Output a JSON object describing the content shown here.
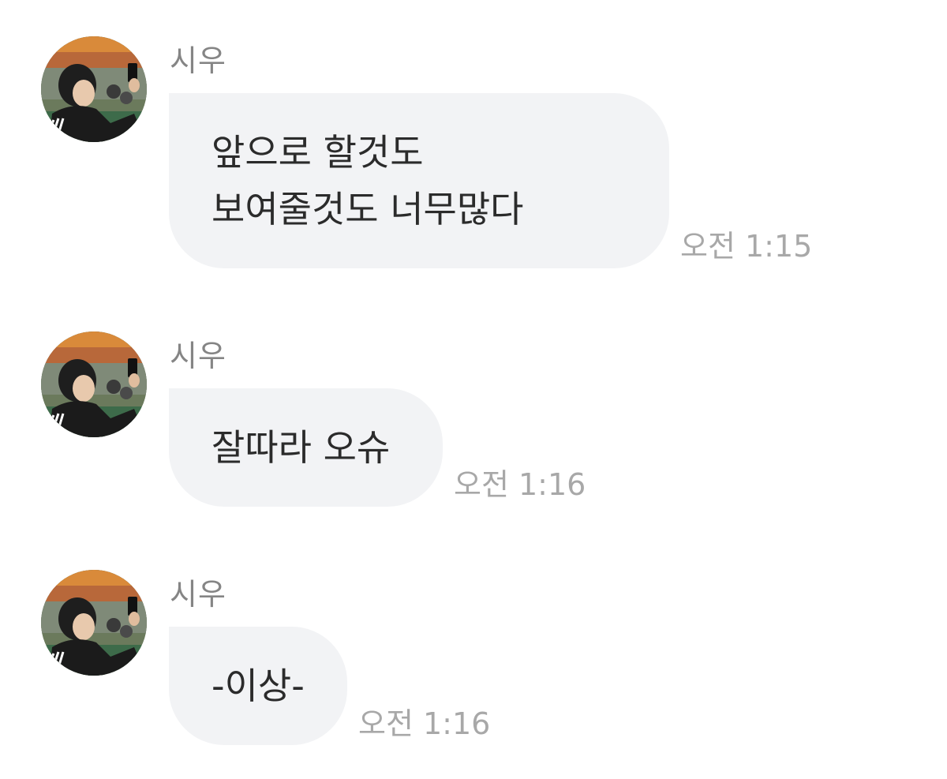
{
  "chat": {
    "messages": [
      {
        "sender": "시우",
        "lines": [
          "앞으로 할것도",
          "보여줄것도 너무많다"
        ],
        "time": "오전 1:15",
        "avatar_icon": "profile-photo-person-holding-phone"
      },
      {
        "sender": "시우",
        "lines": [
          "잘따라 오슈"
        ],
        "time": "오전 1:16",
        "avatar_icon": "profile-photo-person-holding-phone"
      },
      {
        "sender": "시우",
        "lines": [
          "-이상-"
        ],
        "time": "오전 1:16",
        "avatar_icon": "profile-photo-person-holding-phone"
      }
    ]
  },
  "colors": {
    "bubble_background": "#f2f3f5",
    "message_text": "#2b2b2b",
    "sender_name": "#858585",
    "timestamp": "#a8a8a8",
    "page_background": "#ffffff"
  }
}
